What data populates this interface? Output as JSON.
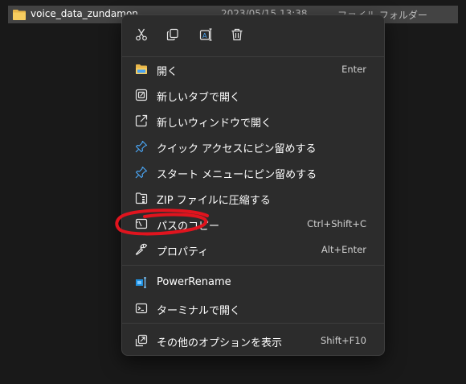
{
  "explorer": {
    "file_name": "voice_data_zundamon",
    "date_modified": "2023/05/15 13:38",
    "file_type": "ファイル フォルダー"
  },
  "quick_actions": [
    {
      "name": "cut",
      "icon": "scissors-icon"
    },
    {
      "name": "copy",
      "icon": "copy-icon"
    },
    {
      "name": "rename",
      "icon": "rename-icon"
    },
    {
      "name": "delete",
      "icon": "trash-icon"
    }
  ],
  "menu": {
    "open": {
      "label": "開く",
      "shortcut": "Enter",
      "icon": "folder-open-icon"
    },
    "open_new_tab": {
      "label": "新しいタブで開く",
      "icon": "new-tab-icon"
    },
    "open_new_window": {
      "label": "新しいウィンドウで開く",
      "icon": "new-window-icon"
    },
    "pin_quick_access": {
      "label": "クイック アクセスにピン留めする",
      "icon": "pin-icon"
    },
    "pin_start": {
      "label": "スタート メニューにピン留めする",
      "icon": "pin-icon"
    },
    "zip": {
      "label": "ZIP ファイルに圧縮する",
      "icon": "zip-folder-icon"
    },
    "copy_path": {
      "label": "パスのコピー",
      "shortcut": "Ctrl+Shift+C",
      "icon": "copy-path-icon"
    },
    "properties": {
      "label": "プロパティ",
      "shortcut": "Alt+Enter",
      "icon": "wrench-icon"
    },
    "power_rename": {
      "label": "PowerRename",
      "icon": "power-rename-icon"
    },
    "terminal": {
      "label": "ターミナルで開く",
      "icon": "terminal-icon"
    },
    "more_options": {
      "label": "その他のオプションを表示",
      "shortcut": "Shift+F10",
      "icon": "more-options-icon"
    }
  },
  "colors": {
    "menu_background": "#2c2c2c",
    "annotation": "#e0141e",
    "accent": "#4aa3f0"
  }
}
